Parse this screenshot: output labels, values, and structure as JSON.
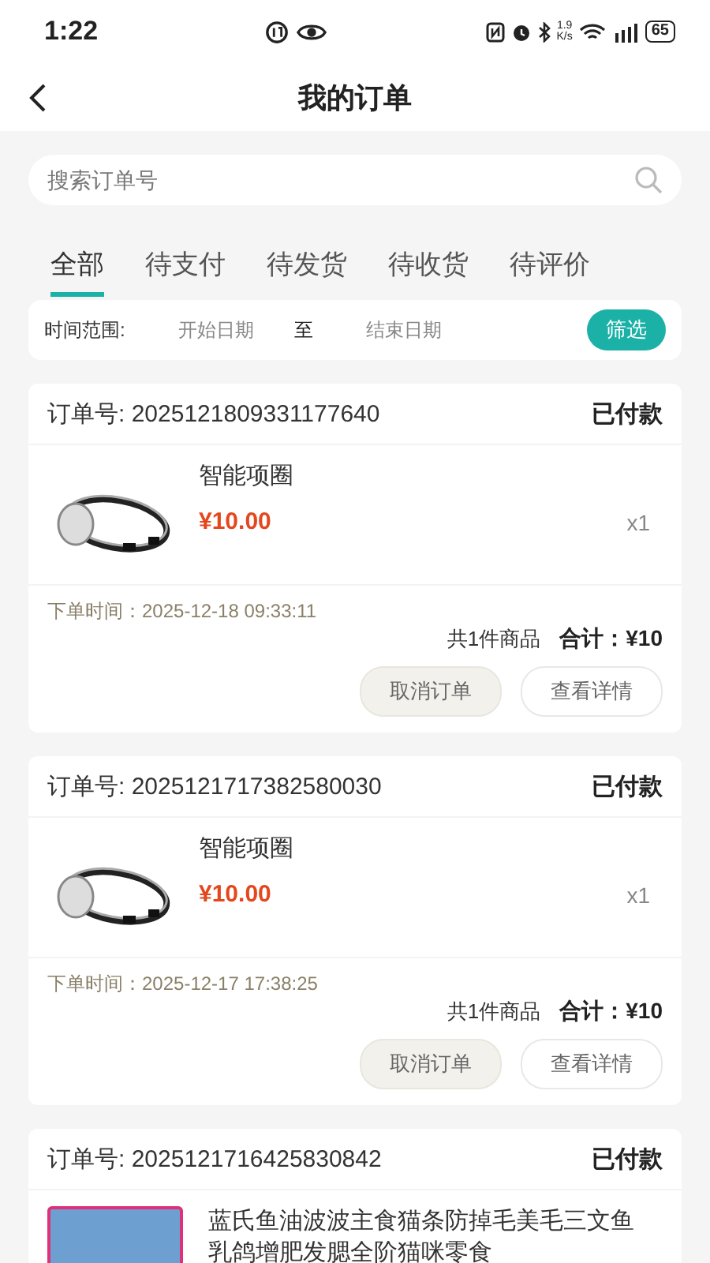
{
  "status_bar": {
    "time": "1:22",
    "net_speed": "1.9",
    "net_unit": "K/s",
    "battery": "65"
  },
  "header": {
    "title": "我的订单"
  },
  "search": {
    "placeholder": "搜索订单号"
  },
  "tabs": [
    {
      "label": "全部",
      "selected": true
    },
    {
      "label": "待支付",
      "selected": false
    },
    {
      "label": "待发货",
      "selected": false
    },
    {
      "label": "待收货",
      "selected": false
    },
    {
      "label": "待评价",
      "selected": false
    }
  ],
  "filter": {
    "label": "时间范围:",
    "start_placeholder": "开始日期",
    "separator": "至",
    "end_placeholder": "结束日期",
    "button": "筛选"
  },
  "orders": [
    {
      "number": "订单号: 2025121809331177640",
      "status": "已付款",
      "items": [
        {
          "kind": "collar",
          "name": "智能项圈",
          "price": "¥10.00",
          "quantity": "x1"
        }
      ],
      "time": "下单时间：2025-12-18 09:33:11",
      "count": "共1件商品",
      "total": "合计：¥10",
      "buttons": [
        {
          "label": "取消订单",
          "kind": "filled"
        },
        {
          "label": "查看详情",
          "kind": "outline"
        }
      ]
    },
    {
      "number": "订单号: 2025121717382580030",
      "status": "已付款",
      "items": [
        {
          "kind": "collar",
          "name": "智能项圈",
          "price": "¥10.00",
          "quantity": "x1"
        }
      ],
      "time": "下单时间：2025-12-17 17:38:25",
      "count": "共1件商品",
      "total": "合计：¥10",
      "buttons": [
        {
          "label": "取消订单",
          "kind": "filled"
        },
        {
          "label": "查看详情",
          "kind": "outline"
        }
      ]
    },
    {
      "number": "订单号: 2025121716425830842",
      "status": "已付款",
      "items": [
        {
          "kind": "photo",
          "name": "蓝氏鱼油波波主食猫条防掉毛美毛三文鱼乳鸽增肥发腮全阶猫咪零食"
        }
      ]
    }
  ]
}
